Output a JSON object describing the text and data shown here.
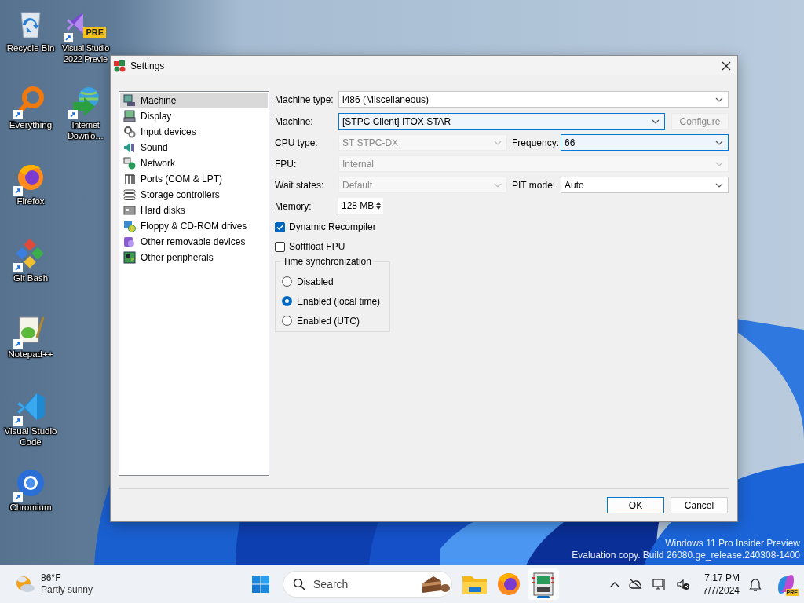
{
  "desktop": {
    "icons": [
      {
        "label": "Recycle Bin",
        "shortcut": false
      },
      {
        "label": "Everything",
        "shortcut": true
      },
      {
        "label": "Firefox",
        "shortcut": true
      },
      {
        "label": "Git Bash",
        "shortcut": true
      },
      {
        "label": "Notepad++",
        "shortcut": true
      },
      {
        "label": "Visual Studio Code",
        "shortcut": true
      },
      {
        "label": "Chromium",
        "shortcut": true
      },
      {
        "label": "Visual Studio 2022 Previe",
        "shortcut": true,
        "badge": "PRE"
      },
      {
        "label": "Internet Downlo…",
        "shortcut": true
      }
    ],
    "watermark": [
      "Windows 11 Pro Insider Preview",
      "Evaluation copy. Build 26080.ge_release.240308-1400"
    ]
  },
  "window": {
    "title": "Settings",
    "sidebar": {
      "items": [
        {
          "label": "Machine",
          "selected": true
        },
        {
          "label": "Display",
          "selected": false
        },
        {
          "label": "Input devices",
          "selected": false
        },
        {
          "label": "Sound",
          "selected": false
        },
        {
          "label": "Network",
          "selected": false
        },
        {
          "label": "Ports (COM & LPT)",
          "selected": false
        },
        {
          "label": "Storage controllers",
          "selected": false
        },
        {
          "label": "Hard disks",
          "selected": false
        },
        {
          "label": "Floppy & CD-ROM drives",
          "selected": false
        },
        {
          "label": "Other removable devices",
          "selected": false
        },
        {
          "label": "Other peripherals",
          "selected": false
        }
      ]
    },
    "form": {
      "rows": [
        {
          "fields": [
            {
              "kind": "combo",
              "label": "Machine type:",
              "value": "i486 (Miscellaneous)",
              "disabled": false,
              "focused": false
            }
          ]
        },
        {
          "fields": [
            {
              "kind": "combo",
              "label": "Machine:",
              "value": "[STPC Client] ITOX STAR",
              "disabled": false,
              "focused": true
            },
            {
              "kind": "button",
              "label": "Configure",
              "disabled": true
            }
          ]
        },
        {
          "fields": [
            {
              "kind": "combo",
              "label": "CPU type:",
              "value": "ST STPC-DX",
              "disabled": true,
              "focused": false
            },
            {
              "kind": "combo",
              "label": "Frequency:",
              "value": "66",
              "disabled": false,
              "focused": true
            }
          ]
        },
        {
          "fields": [
            {
              "kind": "combo",
              "label": "FPU:",
              "value": "Internal",
              "disabled": true,
              "focused": false
            }
          ]
        },
        {
          "fields": [
            {
              "kind": "combo",
              "label": "Wait states:",
              "value": "Default",
              "disabled": true,
              "focused": false
            },
            {
              "kind": "combo",
              "label": "PIT mode:",
              "value": "Auto",
              "disabled": false,
              "focused": false
            }
          ]
        },
        {
          "fields": [
            {
              "kind": "spin",
              "label": "Memory:",
              "value": "128 MB"
            }
          ]
        }
      ],
      "checkboxes": [
        {
          "label": "Dynamic Recompiler",
          "checked": true
        },
        {
          "label": "Softfloat FPU",
          "checked": false
        }
      ],
      "time_sync": {
        "title": "Time synchronization",
        "options": [
          {
            "label": "Disabled",
            "selected": false
          },
          {
            "label": "Enabled (local time)",
            "selected": true
          },
          {
            "label": "Enabled (UTC)",
            "selected": false
          }
        ]
      }
    },
    "buttons": [
      {
        "label": "OK",
        "default": true
      },
      {
        "label": "Cancel",
        "default": false
      }
    ]
  },
  "taskbar": {
    "weather": {
      "temperature": "86°F",
      "condition": "Partly sunny"
    },
    "search": {
      "placeholder": "Search"
    },
    "apps": [
      {
        "active": false
      },
      {
        "active": false
      },
      {
        "active": true
      }
    ],
    "clock": {
      "time": "7:17 PM",
      "date": "7/7/2024"
    },
    "copilot": {
      "badge": "PRE"
    }
  }
}
